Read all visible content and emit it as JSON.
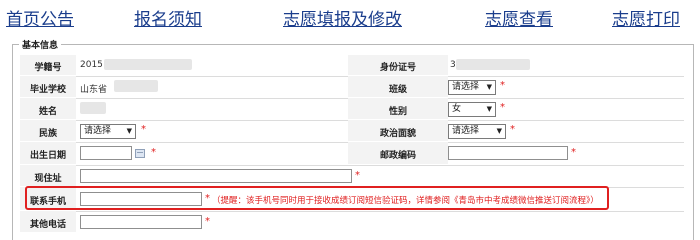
{
  "nav": [
    "首页公告",
    "报名须知",
    "志愿填报及修改",
    "志愿查看",
    "志愿打印"
  ],
  "section_title": "基本信息",
  "fields": {
    "student_no": {
      "label": "学籍号",
      "value": "2015"
    },
    "id_no": {
      "label": "身份证号",
      "value": "3"
    },
    "school": {
      "label": "毕业学校",
      "value": "山东省"
    },
    "class": {
      "label": "班级",
      "value": "请选择"
    },
    "name": {
      "label": "姓名"
    },
    "gender": {
      "label": "性别",
      "value": "女"
    },
    "ethnicity": {
      "label": "民族",
      "value": "请选择"
    },
    "politics": {
      "label": "政治面貌",
      "value": "请选择"
    },
    "birthdate": {
      "label": "出生日期"
    },
    "postcode": {
      "label": "邮政编码"
    },
    "address": {
      "label": "现住址"
    },
    "phone": {
      "label": "联系手机"
    },
    "other_phone": {
      "label": "其他电话"
    }
  },
  "required_mark": "*",
  "phone_hint": "（提醒：该手机号同时用于接收成绩订阅短信验证码，详情参阅《青岛市中考成绩微信推送订阅流程》）",
  "colors": {
    "nav": "#1a3d8c",
    "required": "#e02020",
    "label_bg": "#f3f3f3"
  }
}
